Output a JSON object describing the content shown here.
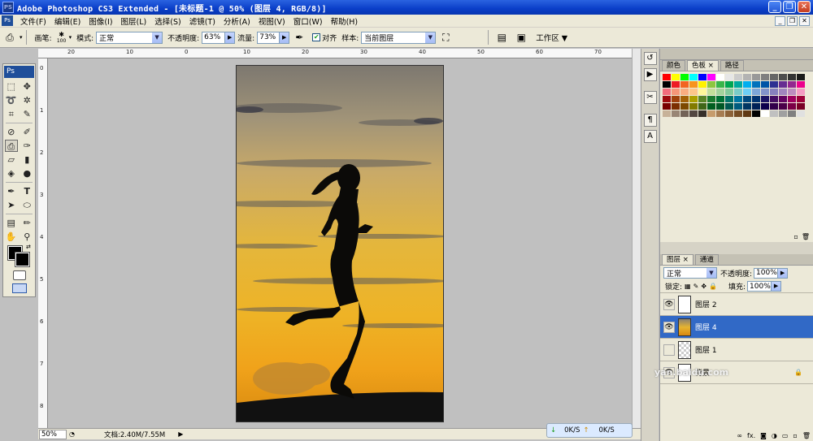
{
  "window": {
    "title": "Adobe Photoshop CS3 Extended - [未标题-1 @ 50% (图层 4, RGB/8)]",
    "app_icon": "PS"
  },
  "menus": [
    "文件(F)",
    "编辑(E)",
    "图像(I)",
    "图层(L)",
    "选择(S)",
    "滤镜(T)",
    "分析(A)",
    "视图(V)",
    "窗口(W)",
    "帮助(H)"
  ],
  "options": {
    "brush_label": "画笔:",
    "brush_size": "100",
    "mode_label": "模式:",
    "mode_value": "正常",
    "opacity_label": "不透明度:",
    "opacity_value": "63%",
    "flow_label": "流量:",
    "flow_value": "73%",
    "aligned_label": "对齐",
    "sample_label": "样本:",
    "sample_value": "当前图层",
    "workspace_label": "工作区 ▼"
  },
  "toolbox": {
    "logo": "Ps"
  },
  "rulers": {
    "top": [
      "20",
      "10",
      "0",
      "10",
      "20",
      "30",
      "40",
      "50",
      "60",
      "70"
    ],
    "left": [
      "0",
      "1",
      "2",
      "3",
      "4",
      "5",
      "6",
      "7",
      "8",
      "9"
    ]
  },
  "status": {
    "zoom": "50%",
    "doc_size": "文档:2.40M/7.55M",
    "play": "▶"
  },
  "netspeed": {
    "down": "0K/S",
    "up": "0K/S"
  },
  "swatches_panel": {
    "tabs": [
      "颜色",
      "色板 ×",
      "路径"
    ],
    "colors": [
      "#ff0000",
      "#ffff00",
      "#00ff00",
      "#00ffff",
      "#0000ff",
      "#ff00ff",
      "#ffffff",
      "#e6e6e6",
      "#cccccc",
      "#b3b3b3",
      "#999999",
      "#808080",
      "#666666",
      "#4d4d4d",
      "#333333",
      "#1a1a1a",
      "#000000",
      "#ed1c24",
      "#f26522",
      "#f7941d",
      "#fff200",
      "#8dc63f",
      "#39b54a",
      "#00a651",
      "#00a99d",
      "#00aeef",
      "#0072bc",
      "#0054a6",
      "#2e3192",
      "#662d91",
      "#92278f",
      "#ec008c",
      "#f26d7d",
      "#f69679",
      "#f9ad81",
      "#fdc689",
      "#fff799",
      "#c4df9b",
      "#a3d39c",
      "#82ca9c",
      "#7accc8",
      "#6dcff6",
      "#7da7d9",
      "#8393ca",
      "#8781bd",
      "#a186be",
      "#bd8cbf",
      "#f49ac2",
      "#9e0b0f",
      "#a0410d",
      "#a36209",
      "#aba000",
      "#598527",
      "#1a7b30",
      "#007236",
      "#00746b",
      "#0076a3",
      "#004a80",
      "#003471",
      "#1b1464",
      "#440e62",
      "#630460",
      "#9e005d",
      "#9e0039",
      "#790000",
      "#7b2e00",
      "#7d4900",
      "#827b00",
      "#406618",
      "#005e20",
      "#005826",
      "#005952",
      "#005b7f",
      "#003663",
      "#002157",
      "#0d004c",
      "#32004b",
      "#4b0049",
      "#7b0046",
      "#7a0026",
      "#c7b299",
      "#998675",
      "#736357",
      "#534741",
      "#37302a",
      "#c69c6d",
      "#a67c52",
      "#8c6239",
      "#754c24",
      "#603913",
      "#000000",
      "#ffffff",
      "#c0c0c0",
      "#a0a0a0",
      "#808080",
      "#e0e0e0"
    ]
  },
  "layers_panel": {
    "tabs": [
      "图层 ×",
      "通道"
    ],
    "blend_mode": "正常",
    "opacity_label": "不透明度:",
    "opacity_value": "100%",
    "lock_label": "锁定:",
    "fill_label": "填充:",
    "fill_value": "100%",
    "layers": [
      {
        "name": "图层 2",
        "visible": true,
        "selected": false
      },
      {
        "name": "图层 4",
        "visible": true,
        "selected": true
      },
      {
        "name": "图层 1",
        "visible": false,
        "selected": false
      },
      {
        "name": "背景",
        "visible": true,
        "selected": false
      }
    ]
  },
  "dock_icons": [
    "history-icon",
    "actions-icon",
    "tools-preset-icon",
    "paragraph-icon",
    "character-icon"
  ],
  "watermark": "yan.baidu.com"
}
